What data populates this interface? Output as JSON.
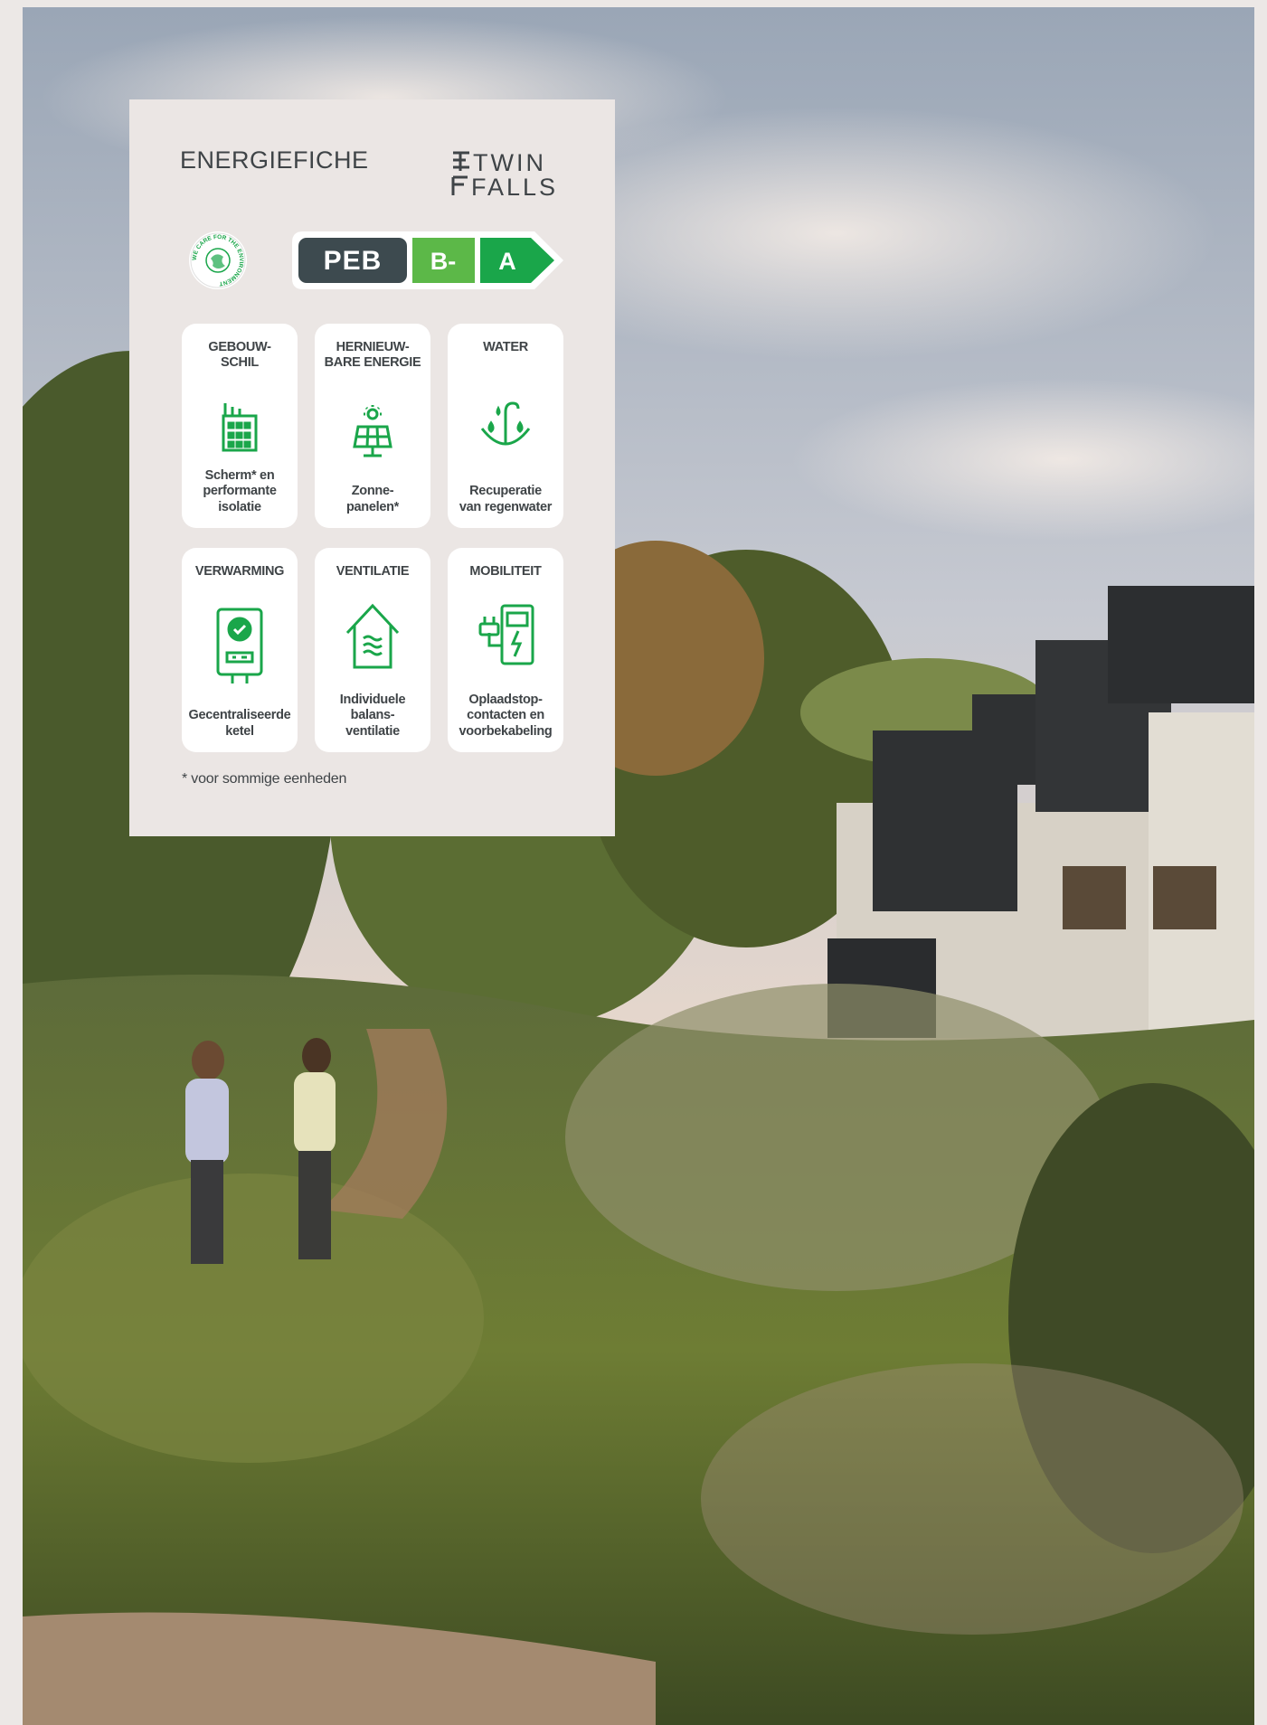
{
  "panel": {
    "title": "ENERGIEFICHE",
    "logo": {
      "line1": "TWIN",
      "line2": "FALLS"
    },
    "env_badge": "WE CARE FOR THE ENVIRONMENT",
    "peb": {
      "label": "PEB",
      "ratings": [
        "B-",
        "A"
      ],
      "colors": [
        "#3d4a4f",
        "#5cb848",
        "#1aa64a"
      ]
    },
    "cards": [
      {
        "head": "GEBOUW-\nSCHIL",
        "icon": "building-icon",
        "desc": "Scherm* en\nperformante\nisolatie"
      },
      {
        "head": "HERNIEUW-\nBARE ENERGIE",
        "icon": "solar-panel-icon",
        "desc": "Zonne-\npanelen*"
      },
      {
        "head": "WATER",
        "icon": "rainwater-umbrella-icon",
        "desc": "Recuperatie\nvan regenwater"
      },
      {
        "head": "VERWARMING",
        "icon": "boiler-icon",
        "desc": "Gecentraliseerde\nketel"
      },
      {
        "head": "VENTILATIE",
        "icon": "house-ventilation-icon",
        "desc": "Individuele\nbalans-\nventilatie"
      },
      {
        "head": "MOBILITEIT",
        "icon": "ev-charger-icon",
        "desc": "Oplaadstop-\ncontacten en\nvoorbekabeling"
      }
    ],
    "footnote": "* voor sommige eenheden",
    "accent": "#1aa64a"
  }
}
